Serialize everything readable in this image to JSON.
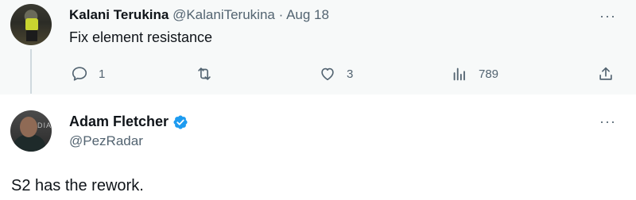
{
  "reply_to": {
    "name": "Kalani Terukina",
    "handle": "@KalaniTerukina",
    "separator": "·",
    "date": "Aug 18",
    "text": "Fix element resistance",
    "actions": {
      "reply_count": "1",
      "retweet_count": "",
      "like_count": "3",
      "views_count": "789"
    }
  },
  "main_tweet": {
    "name": "Adam Fletcher",
    "handle": "@PezRadar",
    "verified": true,
    "avatar_text": "DIA",
    "text": "S2 has the rework."
  },
  "more_glyph": "···",
  "colors": {
    "text_primary": "#0f1419",
    "text_secondary": "#536471",
    "verified_blue": "#1d9bf0",
    "thread_line": "#cfd9de",
    "reply_bg": "#f7f9f9"
  }
}
